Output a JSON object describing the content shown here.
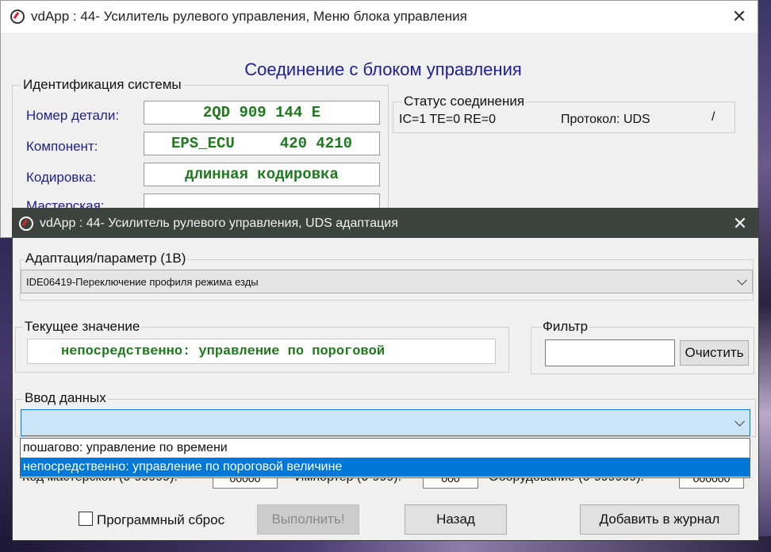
{
  "back_window": {
    "title": "vdApp : 44- Усилитель рулевого управления,  Меню блока управления",
    "heading": "Соединение с блоком управления",
    "identification": {
      "legend": "Идентификация системы",
      "part_number_label": "Номер детали:",
      "part_number_value": "2QD 909 144 E",
      "component_label": "Компонент:",
      "component_value": "EPS_ECU     420 4210",
      "coding_label": "Кодировка:",
      "coding_value": "длинная кодировка",
      "workshop_label": "Мастерская:"
    },
    "status": {
      "legend": "Статус соединения",
      "counters": "IC=1  TE=0   RE=0",
      "protocol": "Протокол: UDS",
      "indicator": "/"
    }
  },
  "dialog": {
    "title": "vdApp : 44- Усилитель рулевого управления,  UDS адаптация",
    "adaptation": {
      "legend": "Адаптация/параметр (1В)",
      "selected": "IDE06419-Переключение профиля режима езды"
    },
    "current_value": {
      "legend": "Текущее значение",
      "value": "непосредственно: управление по пороговой"
    },
    "filter": {
      "legend": "Фильтр",
      "value": "",
      "clear_label": "Очистить"
    },
    "data_entry": {
      "legend": "Ввод данных",
      "value": "",
      "options": [
        "пошагово: управление по времени",
        "непосредственно: управление по пороговой величине"
      ],
      "highlighted_index": 1
    },
    "partial_row": {
      "workshop_code": "Код мастерской (0-99999):",
      "workshop_value": "00000",
      "importer": "Импортер (0-999):",
      "importer_value": "000",
      "equipment": "Оборудование (0-999999):",
      "equipment_value": "000000"
    },
    "reset_label": "Программный сброс",
    "reset_checked": false,
    "execute_label": "Выполнить!",
    "back_label": "Назад",
    "log_label": "Добавить в журнал"
  }
}
